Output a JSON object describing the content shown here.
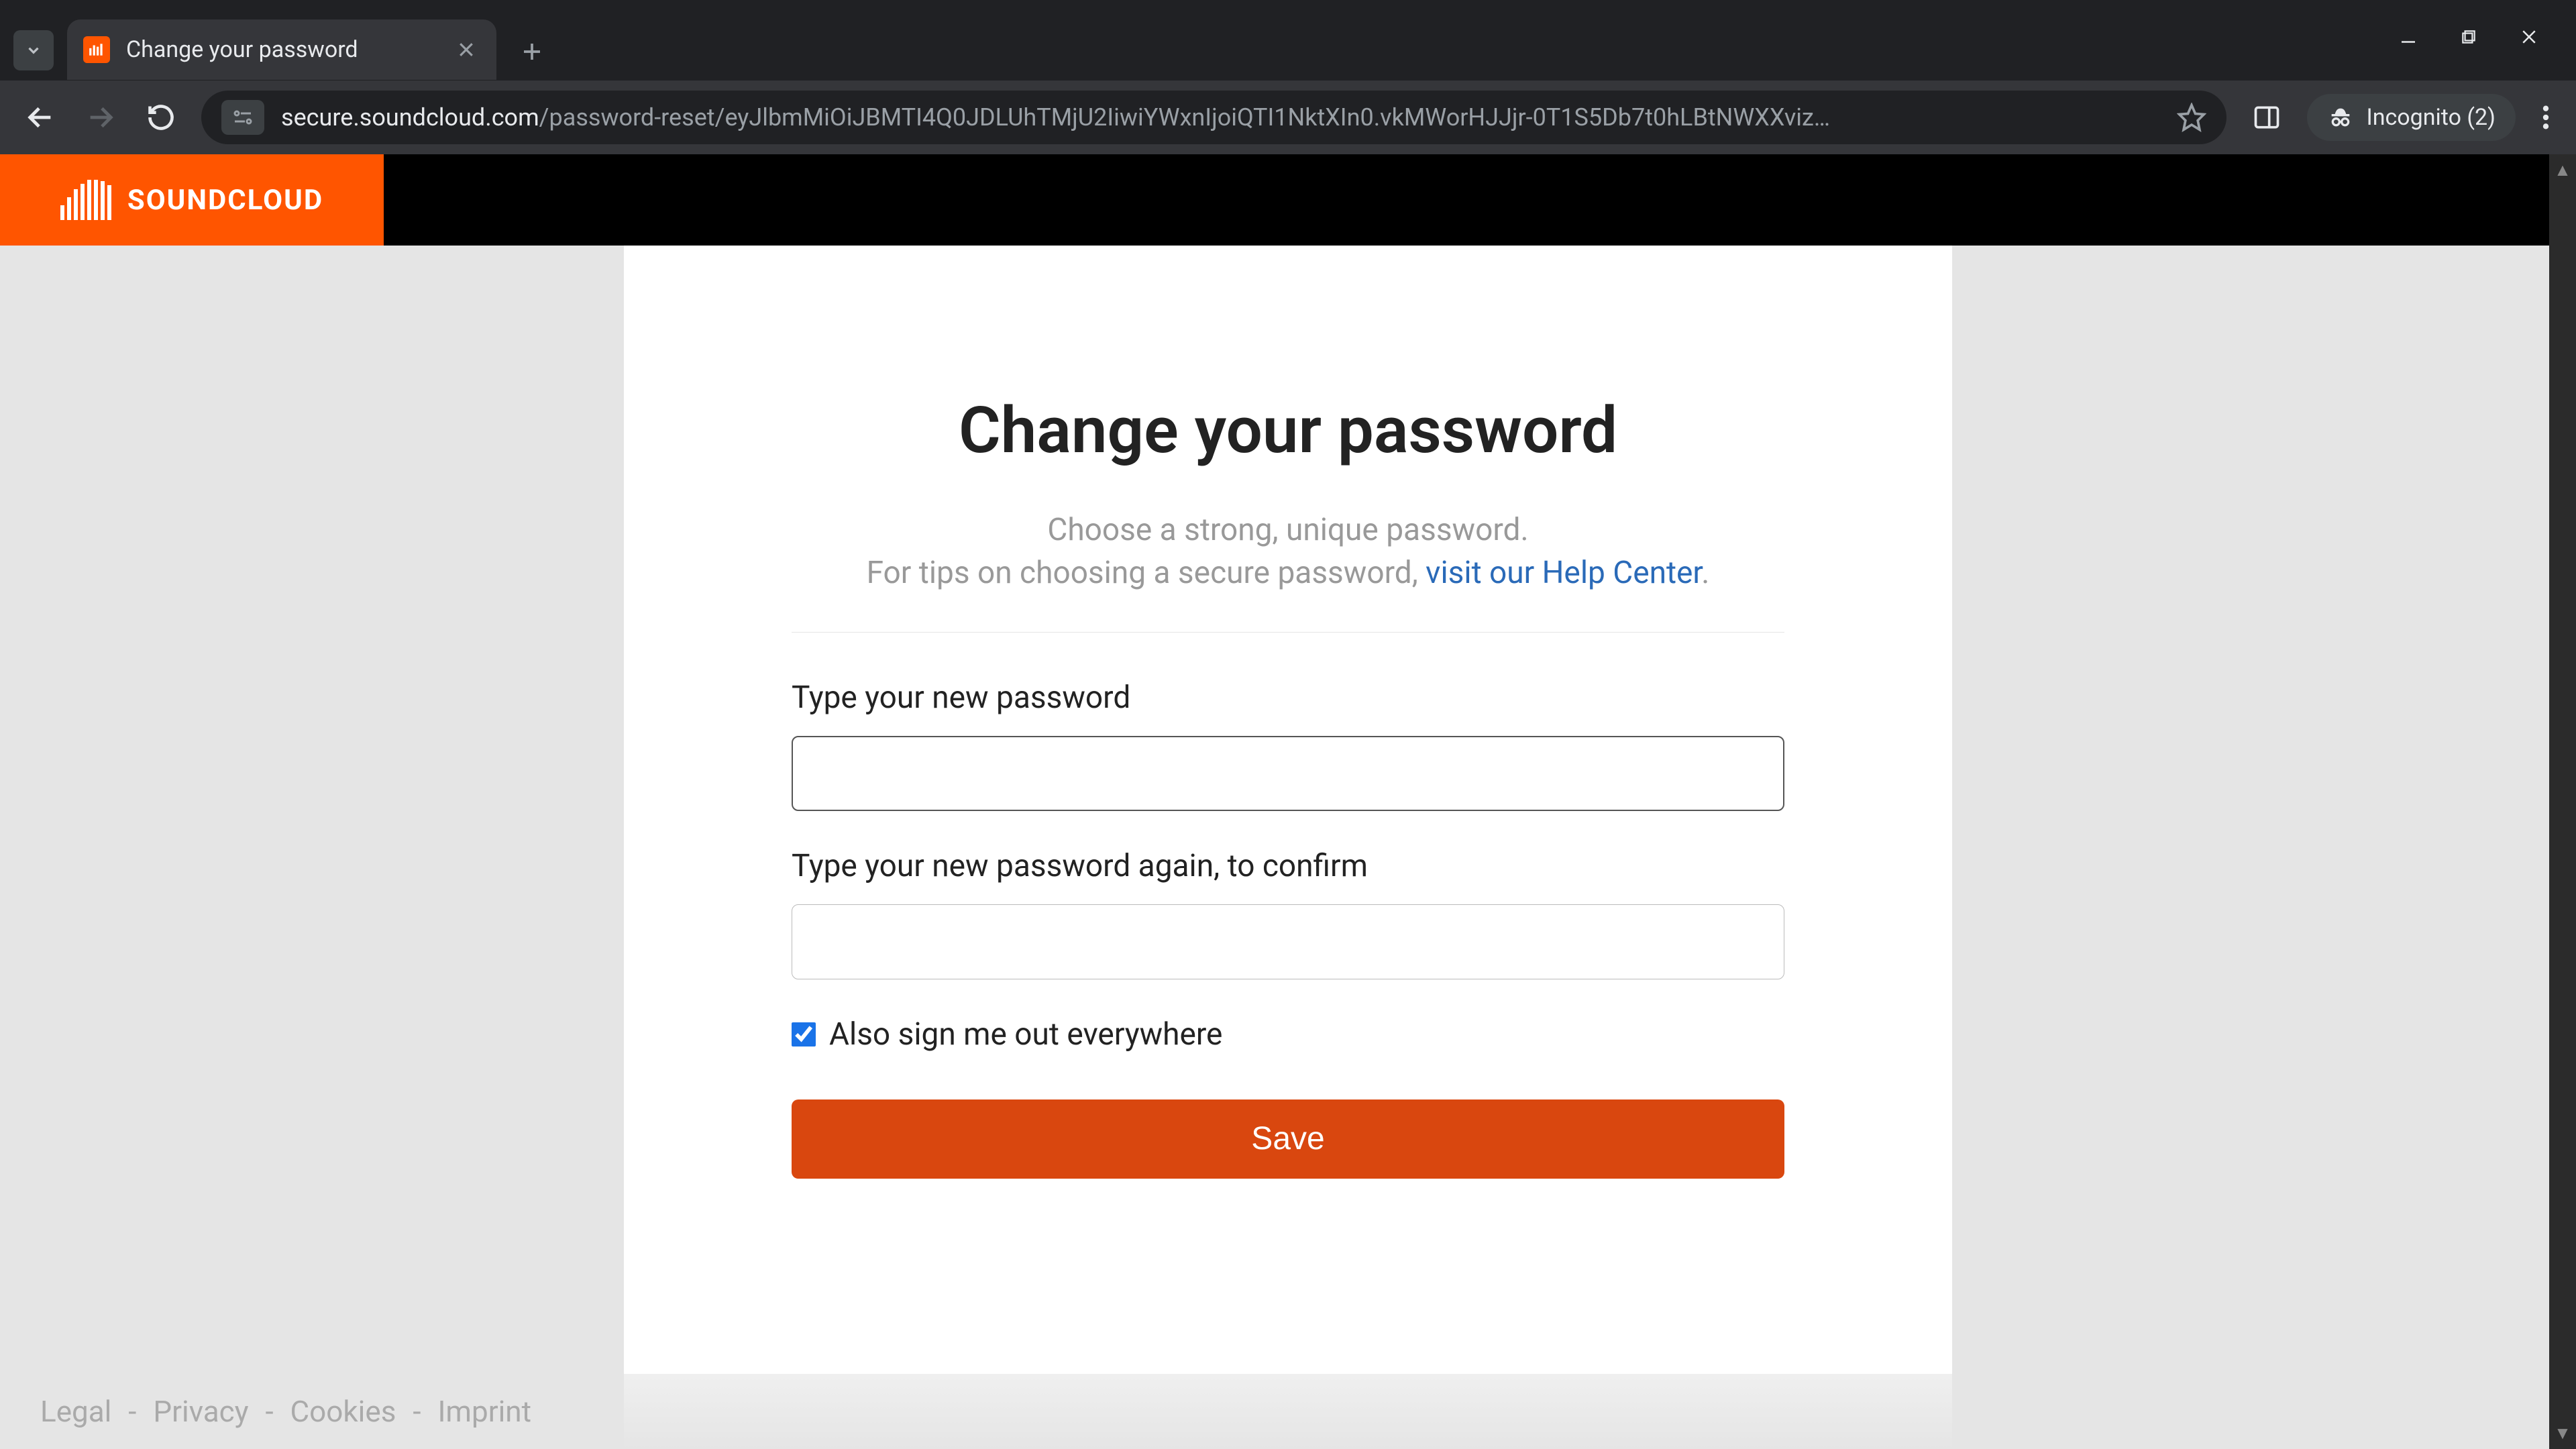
{
  "browser": {
    "tab": {
      "title": "Change your password",
      "favicon_color": "#ff5500"
    },
    "url_domain": "secure.soundcloud.com",
    "url_path": "/password-reset/eyJlbmMiOiJBMTI4Q0JDLUhTMjU2IiwiYWxnIjoiQTI1NktXIn0.vkMWorHJJjr-0T1S5Db7t0hLBtNWXXviz…",
    "incognito_label": "Incognito (2)"
  },
  "header": {
    "brand": "SOUNDCLOUD"
  },
  "page": {
    "title": "Change your password",
    "subtitle_line1": "Choose a strong, unique password.",
    "subtitle_line2_prefix": "For tips on choosing a secure password, ",
    "subtitle_link": "visit our Help Center",
    "subtitle_line2_suffix": ".",
    "label_new_password": "Type your new password",
    "label_confirm_password": "Type your new password again, to confirm",
    "checkbox_label": "Also sign me out everywhere",
    "checkbox_checked": true,
    "save_button": "Save"
  },
  "footer": {
    "links": [
      "Legal",
      "Privacy",
      "Cookies",
      "Imprint"
    ]
  },
  "colors": {
    "accent": "#f50",
    "button": "#d9470f",
    "link": "#2a6ab8"
  }
}
